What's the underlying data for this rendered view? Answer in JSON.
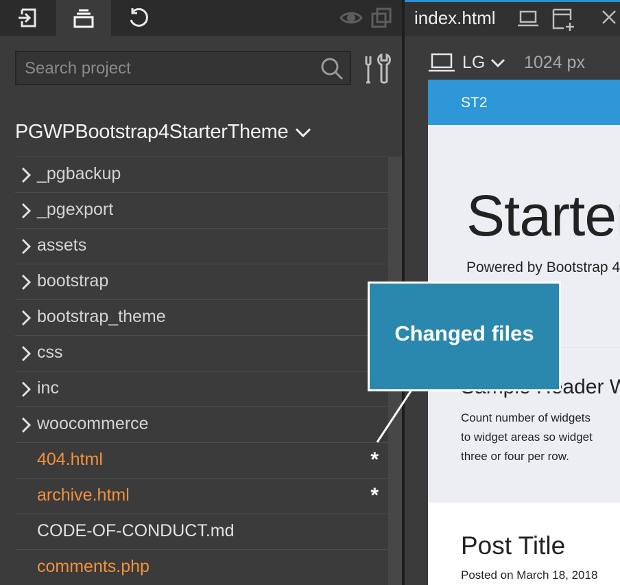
{
  "left_panel": {
    "search": {
      "placeholder": "Search project",
      "value": ""
    },
    "project_name": "PGWPBootstrap4StarterTheme",
    "tree": [
      {
        "label": "_pgbackup",
        "kind": "folder",
        "changed": false
      },
      {
        "label": "_pgexport",
        "kind": "folder",
        "changed": false
      },
      {
        "label": "assets",
        "kind": "folder",
        "changed": false
      },
      {
        "label": "bootstrap",
        "kind": "folder",
        "changed": false
      },
      {
        "label": "bootstrap_theme",
        "kind": "folder",
        "changed": false
      },
      {
        "label": "css",
        "kind": "folder",
        "changed": false
      },
      {
        "label": "inc",
        "kind": "folder",
        "changed": false
      },
      {
        "label": "woocommerce",
        "kind": "folder",
        "changed": false
      },
      {
        "label": "404.html",
        "kind": "file",
        "changed": true,
        "mark": "*"
      },
      {
        "label": "archive.html",
        "kind": "file",
        "changed": true,
        "mark": "*"
      },
      {
        "label": "CODE-OF-CONDUCT.md",
        "kind": "file",
        "changed": false
      },
      {
        "label": "comments.php",
        "kind": "file",
        "changed": true
      }
    ]
  },
  "document_tab": {
    "name": "index.html"
  },
  "device_bar": {
    "size": "LG",
    "width": "1024 px"
  },
  "preview": {
    "brand": "ST2",
    "hero_title": "Starter",
    "hero_subtitle": "Powered by Bootstrap 4",
    "widget_heading": "Sample Header W",
    "widget_lines": [
      "Count number of widgets",
      "to widget areas so widget",
      "three or four per row."
    ],
    "post_title": "Post Title",
    "post_meta": "Posted on March 18, 2018"
  },
  "callout": {
    "text": "Changed files"
  },
  "colors": {
    "accent": "#2e97d7",
    "changed_file": "#f3913c",
    "callout_bg": "#2a87ad"
  },
  "icons": [
    "insert-icon",
    "project-icon",
    "history-icon",
    "eye-icon",
    "duplicate-icon",
    "search-icon",
    "tools-icon",
    "chevron-down-icon",
    "chevron-right-icon",
    "laptop-icon",
    "add-page-icon",
    "close-icon"
  ]
}
